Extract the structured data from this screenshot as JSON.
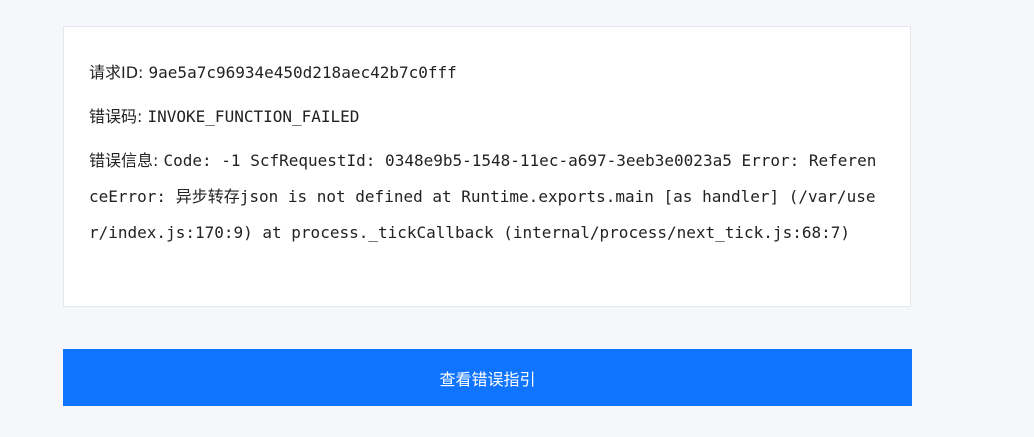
{
  "error_card": {
    "request_id": {
      "label": "请求ID:",
      "value": "9ae5a7c96934e450d218aec42b7c0fff"
    },
    "error_code": {
      "label": "错误码:",
      "value": "INVOKE_FUNCTION_FAILED"
    },
    "error_message": {
      "label": "错误信息:",
      "value": "Code: -1 ScfRequestId: 0348e9b5-1548-11ec-a697-3eeb3e0023a5 Error: ReferenceError: 异步转存json is not defined at Runtime.exports.main [as handler] (/var/user/index.js:170:9) at process._tickCallback (internal/process/next_tick.js:68:7)"
    }
  },
  "guide_button": {
    "label": "查看错误指引"
  },
  "colors": {
    "page_background": "#f5f7fa",
    "card_background": "#ffffff",
    "card_border": "#e3e6eb",
    "button_background": "#0f74ff",
    "button_text": "#ffffff"
  }
}
